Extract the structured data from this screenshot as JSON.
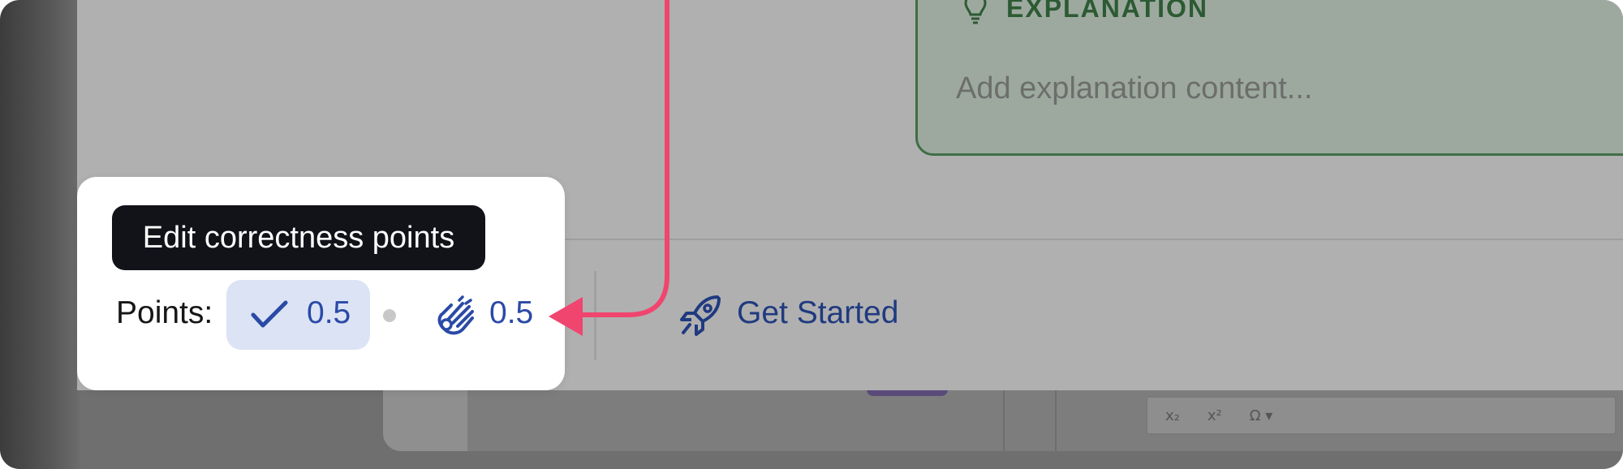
{
  "explanation": {
    "title": "EXPLANATION",
    "placeholder": "Add explanation content..."
  },
  "tooltip": {
    "text": "Edit correctness points"
  },
  "points": {
    "label": "Points:",
    "correctness_value": "0.5",
    "effort_value": "0.5"
  },
  "get_started": {
    "label": "Get Started"
  },
  "toolbar": {
    "subscript": "x₂",
    "superscript": "x²",
    "omega": "Ω ▾"
  },
  "colors": {
    "annotation_arrow": "#f0456e",
    "accent_blue": "#2a4aa6",
    "explanation_green": "#3f6f45",
    "tooltip_bg": "#111319"
  },
  "icons": [
    "lightbulb-icon",
    "checkmark-icon",
    "clapping-hand-icon",
    "rocket-icon"
  ]
}
